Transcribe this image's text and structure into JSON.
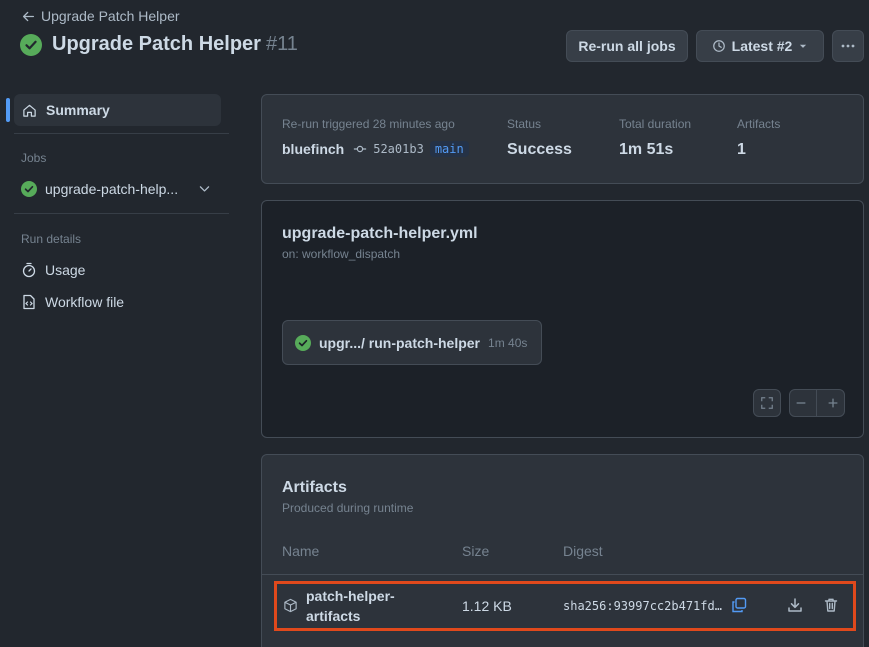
{
  "header": {
    "back_label": "Upgrade Patch Helper",
    "title": "Upgrade Patch Helper",
    "run_number": "#11",
    "rerun_label": "Re-run all jobs",
    "attempt_label": "Latest #2"
  },
  "sidebar": {
    "summary_label": "Summary",
    "jobs_heading": "Jobs",
    "job_label": "upgrade-patch-help...",
    "run_details_heading": "Run details",
    "usage_label": "Usage",
    "workflow_file_label": "Workflow file"
  },
  "summary": {
    "trigger_label": "Re-run triggered 28 minutes ago",
    "actor": "bluefinch",
    "commit_sha": "52a01b3",
    "branch": "main",
    "status_label": "Status",
    "status_value": "Success",
    "duration_label": "Total duration",
    "duration_value": "1m 51s",
    "artifacts_label": "Artifacts",
    "artifacts_value": "1"
  },
  "graph": {
    "workflow_file": "upgrade-patch-helper.yml",
    "trigger": "on: workflow_dispatch",
    "job_name": "upgr.../ run-patch-helper",
    "job_duration": "1m 40s"
  },
  "artifacts": {
    "title": "Artifacts",
    "subtitle": "Produced during runtime",
    "columns": {
      "name": "Name",
      "size": "Size",
      "digest": "Digest"
    },
    "rows": [
      {
        "name_line1": "patch-helper-",
        "name_line2": "artifacts",
        "size": "1.12 KB",
        "digest": "sha256:93997cc2b471fd…"
      }
    ]
  },
  "colors": {
    "background": "#22272e",
    "success": "#57ab5a",
    "accent": "#539bf5",
    "highlight": "#e0491c"
  }
}
